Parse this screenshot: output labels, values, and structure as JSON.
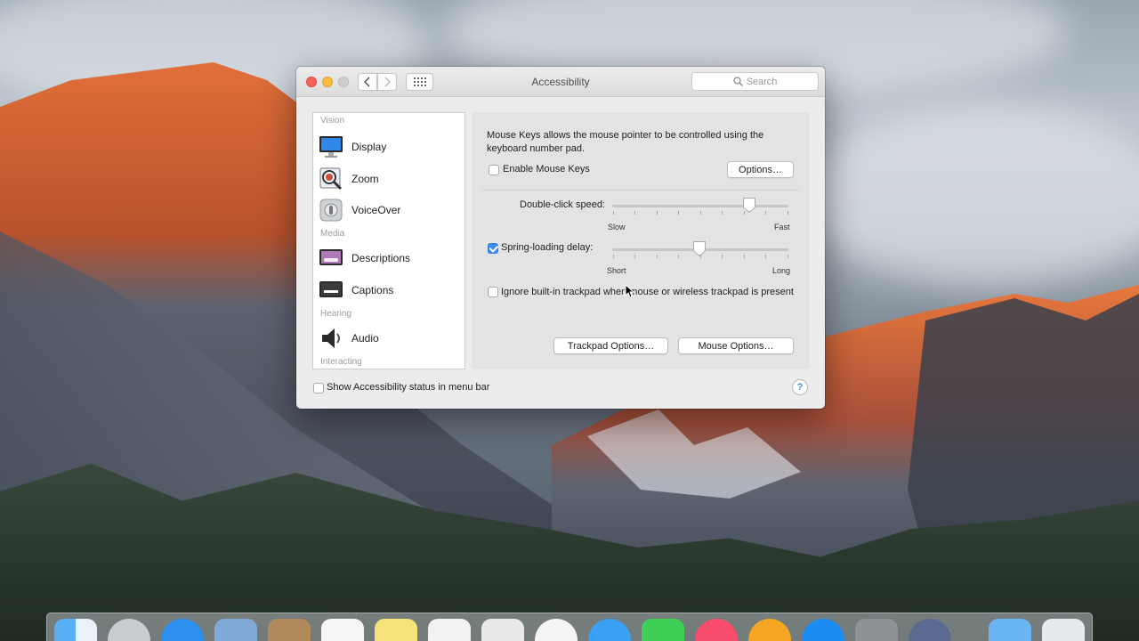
{
  "window": {
    "title": "Accessibility",
    "search_placeholder": "Search"
  },
  "sidebar": {
    "sections": [
      {
        "header": "Vision"
      },
      {
        "header": "Media"
      },
      {
        "header": "Hearing"
      },
      {
        "header": "Interacting"
      }
    ],
    "items": [
      {
        "label": "Display",
        "icon": "display-icon"
      },
      {
        "label": "Zoom",
        "icon": "zoom-icon"
      },
      {
        "label": "VoiceOver",
        "icon": "voiceover-icon"
      },
      {
        "label": "Descriptions",
        "icon": "descriptions-icon"
      },
      {
        "label": "Captions",
        "icon": "captions-icon"
      },
      {
        "label": "Audio",
        "icon": "audio-icon"
      }
    ]
  },
  "mouse_keys": {
    "description": "Mouse Keys allows the mouse pointer to be controlled using the keyboard number pad.",
    "enable_label": "Enable Mouse Keys",
    "enable_checked": false,
    "options_button": "Options…"
  },
  "double_click": {
    "label": "Double-click speed:",
    "min_label": "Slow",
    "max_label": "Fast",
    "value_fraction": 0.78
  },
  "spring_loading": {
    "label": "Spring-loading delay:",
    "checked": true,
    "min_label": "Short",
    "max_label": "Long",
    "value_fraction": 0.5
  },
  "ignore_trackpad": {
    "label": "Ignore built-in trackpad when mouse or wireless trackpad is present",
    "checked": false
  },
  "buttons": {
    "trackpad_options": "Trackpad Options…",
    "mouse_options": "Mouse Options…"
  },
  "footer": {
    "status_label": "Show Accessibility status in menu bar",
    "status_checked": false,
    "help": "?"
  },
  "colors": {
    "accent": "#3d8ef7",
    "close": "#fc605c",
    "minimize": "#fdbc40"
  }
}
